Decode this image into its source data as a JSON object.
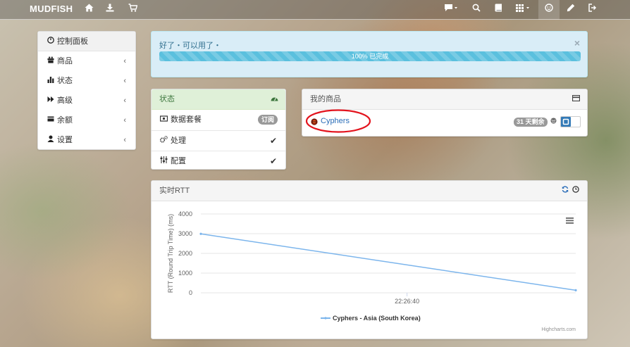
{
  "brand": "MUDFISH",
  "topnav": {
    "left_icons": [
      "home-icon",
      "download-icon",
      "cart-icon"
    ],
    "right_icons": [
      "chat-icon",
      "search-icon",
      "book-icon",
      "grid-icon",
      "user-icon",
      "pencil-icon",
      "logout-icon"
    ]
  },
  "sidebar": {
    "items": [
      {
        "label": "控制面板",
        "icon": "dashboard-icon"
      },
      {
        "label": "商品",
        "icon": "gift-icon"
      },
      {
        "label": "状态",
        "icon": "stats-icon"
      },
      {
        "label": "高级",
        "icon": "forward-icon"
      },
      {
        "label": "余额",
        "icon": "card-icon"
      },
      {
        "label": "设置",
        "icon": "user-icon"
      }
    ]
  },
  "alert": {
    "message": "好了・可以用了・",
    "close": "×",
    "progress_label": "100% 已完成",
    "progress_percent": 100
  },
  "status_panel": {
    "title": "状态",
    "rows": [
      {
        "label": "数据套餐",
        "badge": "订阅"
      },
      {
        "label": "处理",
        "check": "✔"
      },
      {
        "label": "配置",
        "check": "✔"
      }
    ]
  },
  "products_panel": {
    "title": "我的商品",
    "product_name": "Cyphers",
    "days_badge": "31 天剩余"
  },
  "rtt_panel": {
    "title": "实时RTT"
  },
  "chart_data": {
    "type": "line",
    "title": "",
    "ylabel": "RTT (Round Trip Time) (ms)",
    "ylim": [
      0,
      4000
    ],
    "yticks": [
      "4000",
      "3000",
      "2000",
      "1000",
      "0"
    ],
    "xticks": [
      "22:26:40"
    ],
    "series": [
      {
        "name": "Cyphers - Asia (South Korea)",
        "color": "#7cb5ec",
        "x_frac": [
          0,
          1
        ],
        "values": [
          2990,
          130
        ]
      }
    ],
    "legend": "bottom-center",
    "credits": "Highcharts.com"
  }
}
